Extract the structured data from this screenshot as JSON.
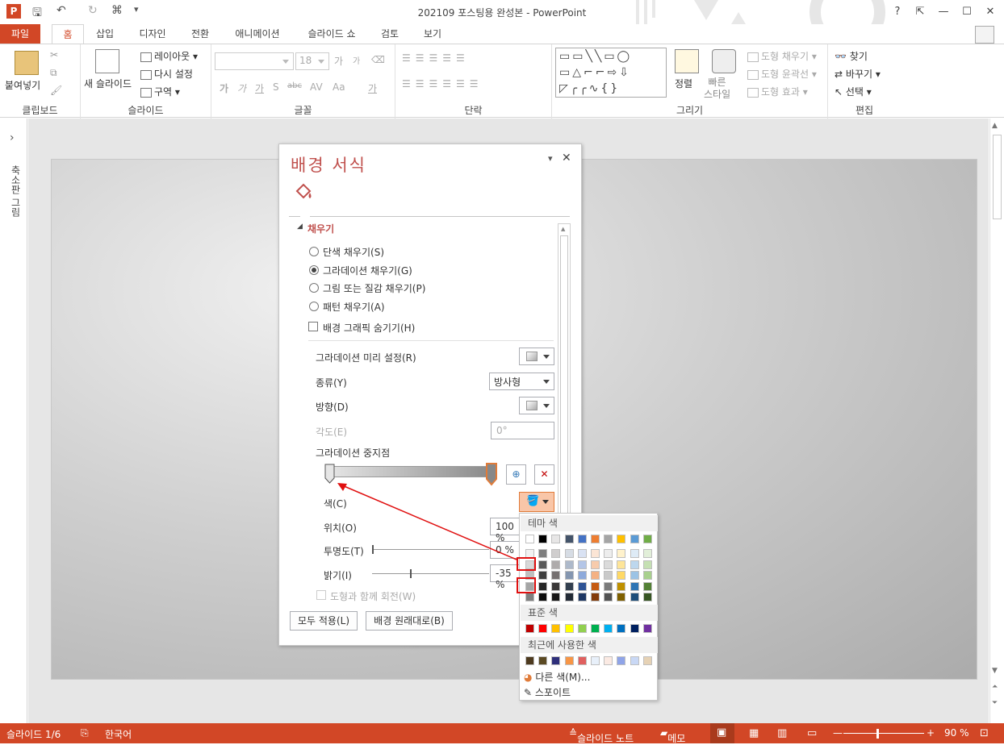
{
  "window": {
    "title": "202109 포스팅용 완성본 - PowerPoint",
    "help": "?",
    "restore": "⇱",
    "minimize": "—",
    "maximize": "☐",
    "close": "✕"
  },
  "qat": {
    "app_icon": "P",
    "save": "🖫",
    "undo": "↶",
    "redo": "↻",
    "present": "⌘",
    "customize": "▾"
  },
  "tabs": [
    "파일",
    "홈",
    "삽입",
    "디자인",
    "전환",
    "애니메이션",
    "슬라이드 쇼",
    "검토",
    "보기"
  ],
  "ribbon": {
    "clipboard": {
      "label": "클립보드",
      "paste": "붙여넣기",
      "paste_arrow": "▾"
    },
    "slides": {
      "label": "슬라이드",
      "new_slide": "새 슬라이드",
      "layout": "레이아웃",
      "reset": "다시 설정",
      "section": "구역"
    },
    "font": {
      "label": "글꼴",
      "font_name": "",
      "font_size": "18",
      "grow": "가",
      "shrink": "가",
      "bold": "가",
      "italic": "가",
      "underline": "가",
      "shadow": "S",
      "strike": "abc",
      "spacing": "AV",
      "case": "Aa",
      "color": "가"
    },
    "paragraph": {
      "label": "단락"
    },
    "drawing": {
      "label": "그리기",
      "arrange": "정렬",
      "quick_styles": "빠른\n스타일",
      "fill": "도형 채우기",
      "outline": "도형 윤곽선",
      "effects": "도형 효과"
    },
    "editing": {
      "label": "편집",
      "find": "찾기",
      "replace": "바꾸기",
      "select": "선택"
    }
  },
  "left_pane": {
    "label": "축소판 그림",
    "toggle": "›"
  },
  "format_pane": {
    "title": "배경 서식",
    "section": "채우기",
    "fill_options": [
      {
        "label": "단색 채우기(S)",
        "selected": false
      },
      {
        "label": "그라데이션 채우기(G)",
        "selected": true
      },
      {
        "label": "그림 또는 질감 채우기(P)",
        "selected": false
      },
      {
        "label": "패턴 채우기(A)",
        "selected": false
      }
    ],
    "hide_graphics": "배경 그래픽 숨기기(H)",
    "preset_label": "그라데이션 미리 설정(R)",
    "type_label": "종류(Y)",
    "type_value": "방사형",
    "direction_label": "방향(D)",
    "angle_label": "각도(E)",
    "angle_value": "0°",
    "stops_label": "그라데이션 중지점",
    "color_label": "색(C)",
    "position_label": "위치(O)",
    "position_value": "100 %",
    "transparency_label": "투명도(T)",
    "transparency_value": "0 %",
    "brightness_label": "밝기(I)",
    "brightness_value": "-35 %",
    "rotate_label": "도형과 함께 회전(W)",
    "apply_all": "모두 적용(L)",
    "reset_bg": "배경 원래대로(B)",
    "pin": "▾",
    "close": "✕"
  },
  "color_popup": {
    "theme_label": "테마 색",
    "standard_label": "표준 색",
    "recent_label": "최근에 사용한 색",
    "more_colors": "다른 색(M)...",
    "eyedropper": "스포이트",
    "theme_top": [
      "#ffffff",
      "#000000",
      "#e7e6e6",
      "#44546a",
      "#4472c4",
      "#ed7d31",
      "#a5a5a5",
      "#ffc000",
      "#5b9bd5",
      "#70ad47"
    ],
    "theme_shades": [
      [
        "#f2f2f2",
        "#7f7f7f",
        "#d0cece",
        "#d6dce4",
        "#d9e2f3",
        "#fbe5d5",
        "#ededed",
        "#fff2cc",
        "#deebf6",
        "#e2efd9"
      ],
      [
        "#d8d8d8",
        "#595959",
        "#aeabab",
        "#adb9ca",
        "#b4c6e7",
        "#f7cbac",
        "#dbdbdb",
        "#fee599",
        "#bdd7ee",
        "#c5e0b3"
      ],
      [
        "#bfbfbf",
        "#3f3f3f",
        "#757070",
        "#8496b0",
        "#8eaadb",
        "#f4b183",
        "#c9c9c9",
        "#ffd965",
        "#9cc3e5",
        "#a8d08d"
      ],
      [
        "#a5a5a5",
        "#262626",
        "#3a3838",
        "#323f4f",
        "#2f5496",
        "#c55a11",
        "#7b7b7b",
        "#bf9000",
        "#2e75b5",
        "#538135"
      ],
      [
        "#7f7f7f",
        "#0c0c0c",
        "#171616",
        "#222a35",
        "#1f3864",
        "#833c0b",
        "#525252",
        "#7f6000",
        "#1e4e79",
        "#375623"
      ]
    ],
    "standard": [
      "#c00000",
      "#ff0000",
      "#ffc000",
      "#ffff00",
      "#92d050",
      "#00b050",
      "#00b0f0",
      "#0070c0",
      "#002060",
      "#7030a0"
    ],
    "recent": [
      "#4d3a1f",
      "#5b4a23",
      "#2e2f7a",
      "#f79646",
      "#e0605f",
      "#e8f0fa",
      "#fbeae3",
      "#8fa4e8",
      "#c9d8f5",
      "#e6d2b5"
    ]
  },
  "status": {
    "slide": "슬라이드 1/6",
    "language": "한국어",
    "notes": "슬라이드 노트",
    "comments": "메모",
    "zoom": "90 %"
  }
}
